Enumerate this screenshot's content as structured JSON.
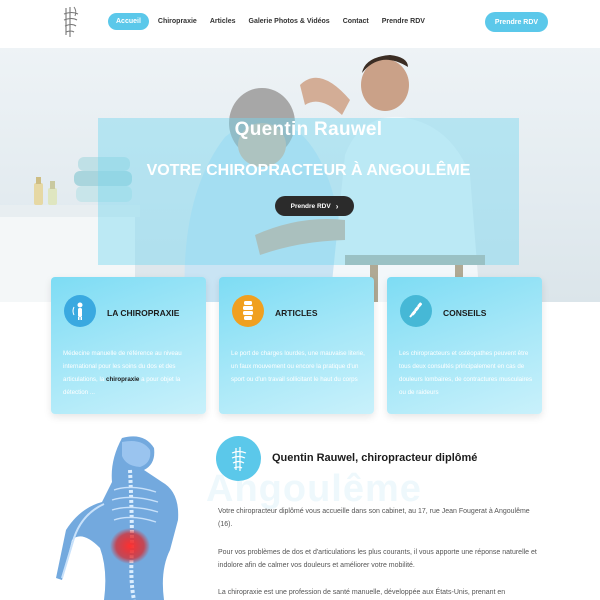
{
  "header": {
    "nav": [
      "Accueil",
      "Chiropraxie",
      "Articles",
      "Galerie Photos & Vidéos",
      "Contact",
      "Prendre RDV"
    ],
    "cta_label": "Prendre RDV"
  },
  "hero": {
    "name": "Quentin Rauwel",
    "title": "VOTRE CHIROPRACTEUR À ANGOULÊME",
    "button_label": "Prendre RDV"
  },
  "cards": [
    {
      "title": "LA CHIROPRAXIE",
      "text_before": "Médecine manuelle de référence au niveau international pour les soins du dos et des articulations, la ",
      "text_bold": "chiropraxie",
      "text_after": " a pour objet la détection ..."
    },
    {
      "title": "ARTICLES",
      "text": "Le port de charges lourdes, une mauvaise literie, un faux mouvement ou encore la pratique d'un sport ou d'un travail sollicitant le haut du corps"
    },
    {
      "title": "CONSEILS",
      "text": "Les chiropracteurs et ostéopathes peuvent être tous deux consultés principalement en cas de douleurs lombaires, de contractures musculaires ou de raideurs"
    }
  ],
  "about": {
    "background_word": "Angoulême",
    "title": "Quentin Rauwel, chiropracteur diplômé",
    "paragraphs": [
      "Votre chiropracteur diplômé vous accueille dans son cabinet, au 17, rue Jean Fougerat à Angoulême (16).",
      "Pour vos problèmes de dos et d'articulations les plus courants, il vous apporte une réponse naturelle et indolore afin de calmer vos douleurs et améliorer votre mobilité.",
      "La chiropraxie est une profession de santé manuelle, développée aux États-Unis, prenant en"
    ]
  },
  "colors": {
    "accent": "#5bc8ea",
    "card_icon_1": "#3aa9e0",
    "card_icon_2": "#f0a020",
    "card_icon_3": "#46b8d6",
    "dark_button": "#2b2b2b"
  },
  "icons": [
    "logo-icon",
    "posture-icon",
    "spine-icon",
    "vertebra-icon",
    "spine-logo-icon",
    "chevron-right-icon"
  ]
}
